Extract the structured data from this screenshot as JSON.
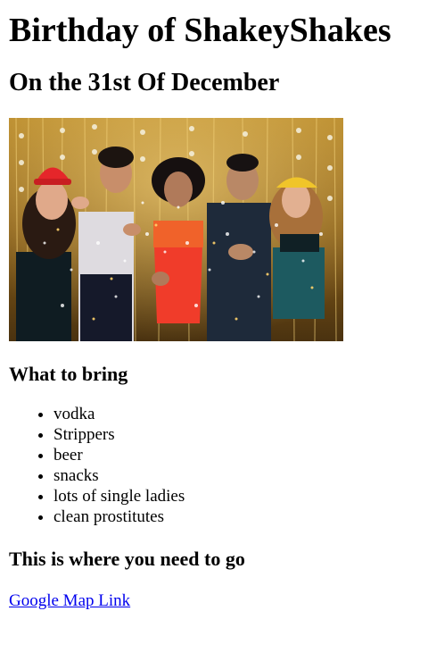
{
  "page": {
    "title": "Birthday of ShakeyShakes",
    "subtitle": "On the 31st Of December"
  },
  "bring": {
    "heading": "What to bring",
    "items": [
      "vodka",
      "Strippers",
      "beer",
      "snacks",
      "lots of single ladies",
      "clean prostitutes"
    ]
  },
  "location": {
    "heading": "This is where you need to go",
    "link_text": "Google Map Link"
  },
  "colors": {
    "link": "#0000ee",
    "text": "#000000"
  }
}
